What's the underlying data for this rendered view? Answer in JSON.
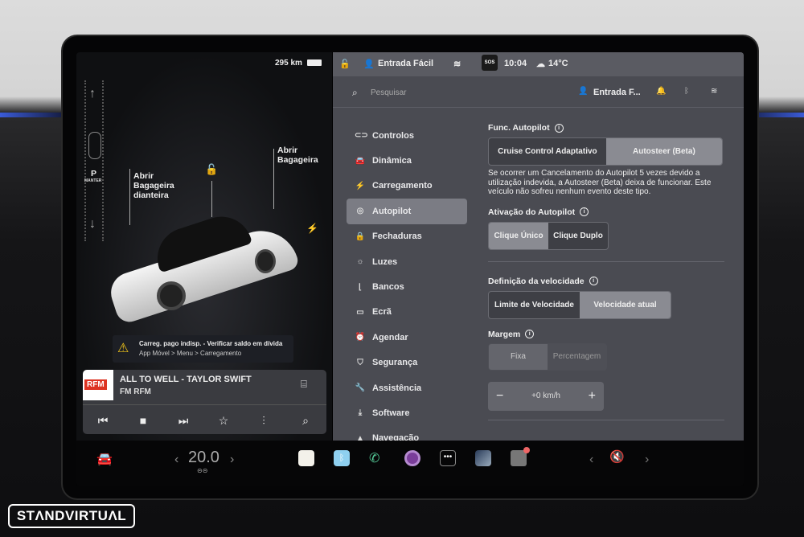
{
  "left_panel": {
    "range": "295 km",
    "gear": "P",
    "gear_sub": "MANTER",
    "frunk_label": "Abrir Bagageira dianteira",
    "trunk_label": "Abrir Bagageira",
    "alert_line1": "Carreg. pago indisp. - Verificar saldo em dívida",
    "alert_line2": "App Móvel > Menu > Carregamento"
  },
  "media": {
    "logo": "RFM",
    "title": "ALL TO WELL - TAYLOR SWIFT",
    "source": "FM RFM"
  },
  "status_bar": {
    "profile": "Entrada Fácil",
    "sos": "SOS",
    "time": "10:04",
    "temperature": "14°C"
  },
  "header": {
    "search_placeholder": "Pesquisar",
    "profile": "Entrada F..."
  },
  "menu": [
    {
      "label": "Controlos",
      "icon": "toggle-icon",
      "glyph": "⊂⊃"
    },
    {
      "label": "Dinâmica",
      "icon": "car-icon",
      "glyph": "🚘"
    },
    {
      "label": "Carregamento",
      "icon": "bolt-icon",
      "glyph": "⚡"
    },
    {
      "label": "Autopilot",
      "icon": "steering-wheel-icon",
      "glyph": "◎"
    },
    {
      "label": "Fechaduras",
      "icon": "lock-icon",
      "glyph": "🔒"
    },
    {
      "label": "Luzes",
      "icon": "sun-icon",
      "glyph": "☼"
    },
    {
      "label": "Bancos",
      "icon": "seat-icon",
      "glyph": "⌊"
    },
    {
      "label": "Ecrã",
      "icon": "display-icon",
      "glyph": "▭"
    },
    {
      "label": "Agendar",
      "icon": "alarm-icon",
      "glyph": "⏰"
    },
    {
      "label": "Segurança",
      "icon": "shield-icon",
      "glyph": "⛉"
    },
    {
      "label": "Assistência",
      "icon": "wrench-icon",
      "glyph": "🔧"
    },
    {
      "label": "Software",
      "icon": "download-icon",
      "glyph": "⤓"
    },
    {
      "label": "Navegação",
      "icon": "navigation-icon",
      "glyph": "▲"
    }
  ],
  "autopilot": {
    "func_title": "Func. Autopilot",
    "func_options": [
      "Cruise Control Adaptativo",
      "Autosteer (Beta)"
    ],
    "description": "Se ocorrer um Cancelamento do Autopilot 5 vezes devido a utilização indevida, a Autosteer (Beta) deixa de funcionar. Este veículo não sofreu nenhum evento deste tipo.",
    "activation_title": "Ativação do Autopilot",
    "activation_options": [
      "Clique Único",
      "Clique Duplo"
    ],
    "speed_title": "Definição da velocidade",
    "speed_options": [
      "Limite de Velocidade",
      "Velocidade atual"
    ],
    "margin_title": "Margem",
    "margin_options": [
      "Fixa",
      "Percentagem"
    ],
    "margin_value": "+0 km/h",
    "minus": "−",
    "plus": "+"
  },
  "taskbar": {
    "temperature": "20.0"
  },
  "watermark": "STANDVIRTUAL"
}
